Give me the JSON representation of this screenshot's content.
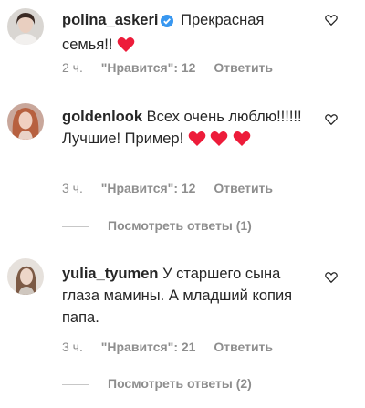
{
  "comments": [
    {
      "username": "polina_askeri",
      "verified": true,
      "text": "Прекрасная семья!!",
      "hearts": 1,
      "time": "2 ч.",
      "likes": "\"Нравится\": 12",
      "reply": "Ответить"
    },
    {
      "username": "goldenlook",
      "verified": false,
      "text": "Всех очень люблю!!!!!! Лучшие! Пример!",
      "hearts": 3,
      "time": "3 ч.",
      "likes": "\"Нравится\": 12",
      "reply": "Ответить",
      "view_replies": "Посмотреть ответы (1)"
    },
    {
      "username": "yulia_tyumen",
      "verified": false,
      "text": "У старшего сына глаза мамины. А младший копия папа.",
      "hearts": 0,
      "time": "3 ч.",
      "likes": "\"Нравится\": 21",
      "reply": "Ответить",
      "view_replies": "Посмотреть ответы (2)"
    }
  ],
  "colors": {
    "text": "#262626",
    "muted": "#8e8e8e",
    "heart": "#ed1c3a",
    "verified": "#3897f0"
  },
  "icons": {
    "like": "heart-outline-icon",
    "verified": "verified-badge-icon",
    "emoji": "red-heart-emoji-icon"
  }
}
